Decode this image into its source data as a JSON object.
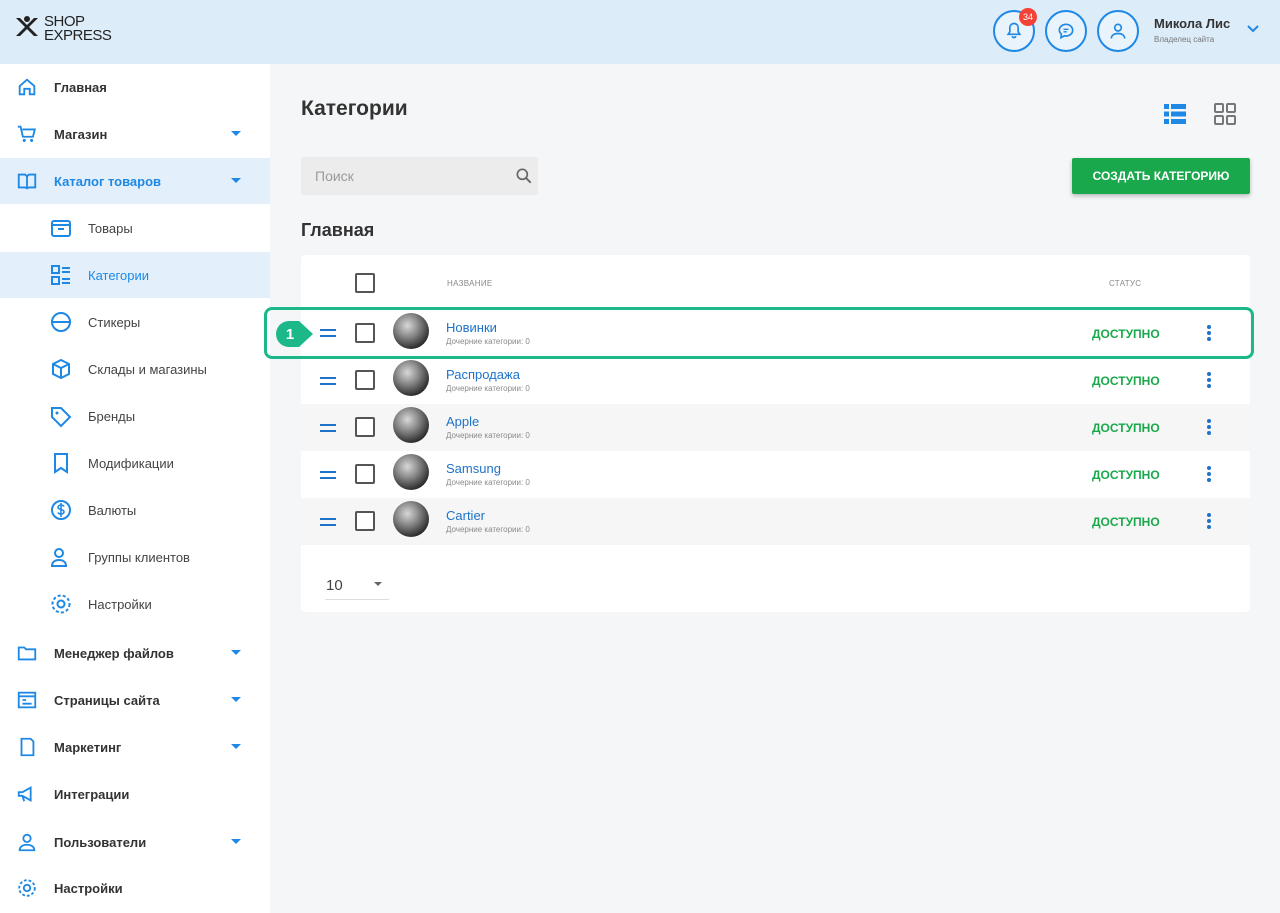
{
  "header": {
    "logo_line1": "SHOP",
    "logo_line2": "EXPRESS",
    "notifications_count": "34",
    "user_name": "Микола Лис",
    "user_role": "Владелец сайта"
  },
  "sidebar": {
    "items": [
      {
        "label": "Главная",
        "icon": "home-icon"
      },
      {
        "label": "Магазин",
        "icon": "cart-icon",
        "expandable": true
      },
      {
        "label": "Каталог товаров",
        "icon": "book-icon",
        "expandable": true,
        "active": true
      },
      {
        "label": "Товары",
        "icon": "box-icon",
        "sub": true
      },
      {
        "label": "Категории",
        "icon": "categories-icon",
        "sub": true,
        "active": true
      },
      {
        "label": "Стикеры",
        "icon": "sticker-icon",
        "sub": true
      },
      {
        "label": "Склады и магазины",
        "icon": "warehouse-icon",
        "sub": true
      },
      {
        "label": "Бренды",
        "icon": "tag-icon",
        "sub": true
      },
      {
        "label": "Модификации",
        "icon": "bookmark-icon",
        "sub": true
      },
      {
        "label": "Валюты",
        "icon": "dollar-icon",
        "sub": true
      },
      {
        "label": "Группы клиентов",
        "icon": "users-icon",
        "sub": true
      },
      {
        "label": "Настройки",
        "icon": "gear-icon",
        "sub": true
      },
      {
        "label": "Менеджер файлов",
        "icon": "folder-icon",
        "expandable": true
      },
      {
        "label": "Страницы сайта",
        "icon": "pages-icon",
        "expandable": true
      },
      {
        "label": "Маркетинг",
        "icon": "marketing-icon",
        "expandable": true
      },
      {
        "label": "Интеграции",
        "icon": "megaphone-icon"
      },
      {
        "label": "Пользователи",
        "icon": "user-icon",
        "expandable": true
      },
      {
        "label": "Настройки",
        "icon": "gear-icon"
      }
    ]
  },
  "main": {
    "title": "Категории",
    "search_placeholder": "Поиск",
    "create_button": "СОЗДАТЬ КАТЕГОРИЮ",
    "section_title": "Главная",
    "table": {
      "col_name": "НАЗВАНИЕ",
      "col_status": "СТАТУС",
      "rows": [
        {
          "name": "Новинки",
          "sub": "Дочерние категории: 0",
          "status": "ДОСТУПНО"
        },
        {
          "name": "Распродажа",
          "sub": "Дочерние категории: 0",
          "status": "ДОСТУПНО"
        },
        {
          "name": "Apple",
          "sub": "Дочерние категории: 0",
          "status": "ДОСТУПНО"
        },
        {
          "name": "Samsung",
          "sub": "Дочерние категории: 0",
          "status": "ДОСТУПНО"
        },
        {
          "name": "Cartier",
          "sub": "Дочерние категории: 0",
          "status": "ДОСТУПНО"
        }
      ]
    },
    "per_page": "10"
  },
  "annotation": {
    "step": "1"
  },
  "colors": {
    "accent": "#1e88e5",
    "success": "#1aa84c",
    "highlight": "#1cb88a",
    "header_bg": "#dcecf9"
  }
}
